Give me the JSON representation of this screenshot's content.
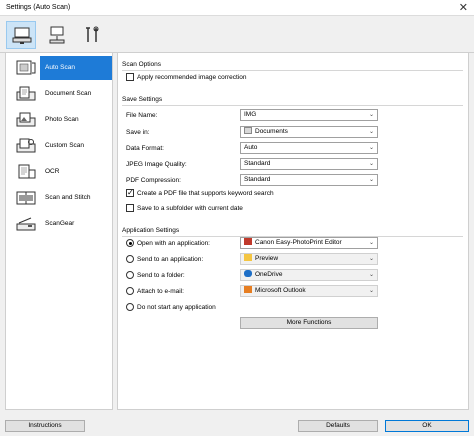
{
  "window": {
    "title": "Settings (Auto Scan)"
  },
  "toolbar": {
    "tabs": [
      {
        "icon": "scan-computer-icon"
      },
      {
        "icon": "network-scan-icon"
      },
      {
        "icon": "general-tools-icon"
      }
    ]
  },
  "sidebar": {
    "items": [
      {
        "label": "Auto Scan",
        "icon": "auto-scan-icon"
      },
      {
        "label": "Document Scan",
        "icon": "document-scan-icon"
      },
      {
        "label": "Photo Scan",
        "icon": "photo-scan-icon"
      },
      {
        "label": "Custom Scan",
        "icon": "custom-scan-icon"
      },
      {
        "label": "OCR",
        "icon": "ocr-icon"
      },
      {
        "label": "Scan and Stitch",
        "icon": "scan-and-stitch-icon"
      },
      {
        "label": "ScanGear",
        "icon": "scangear-icon"
      }
    ]
  },
  "scan_options": {
    "title": "Scan Options",
    "apply_correction": "Apply recommended image correction"
  },
  "save_settings": {
    "title": "Save Settings",
    "file_name_label": "File Name:",
    "file_name_value": "IMG",
    "save_in_label": "Save in:",
    "save_in_value": "Documents",
    "data_format_label": "Data Format:",
    "data_format_value": "Auto",
    "jpeg_quality_label": "JPEG Image Quality:",
    "jpeg_quality_value": "Standard",
    "pdf_compression_label": "PDF Compression:",
    "pdf_compression_value": "Standard",
    "create_pdf_keyword": "Create a PDF file that supports keyword search",
    "save_subfolder": "Save to a subfolder with current date"
  },
  "app_settings": {
    "title": "Application Settings",
    "open_with_label": "Open with an application:",
    "open_with_value": "Canon Easy-PhotoPrint Editor",
    "send_to_app_label": "Send to an application:",
    "send_to_app_value": "Preview",
    "send_to_folder_label": "Send to a folder:",
    "send_to_folder_value": "OneDrive",
    "attach_email_label": "Attach to e-mail:",
    "attach_email_value": "Microsoft Outlook",
    "do_not_start_label": "Do not start any application",
    "more_functions": "More Functions"
  },
  "footer": {
    "instructions": "Instructions",
    "defaults": "Defaults",
    "ok": "OK"
  }
}
